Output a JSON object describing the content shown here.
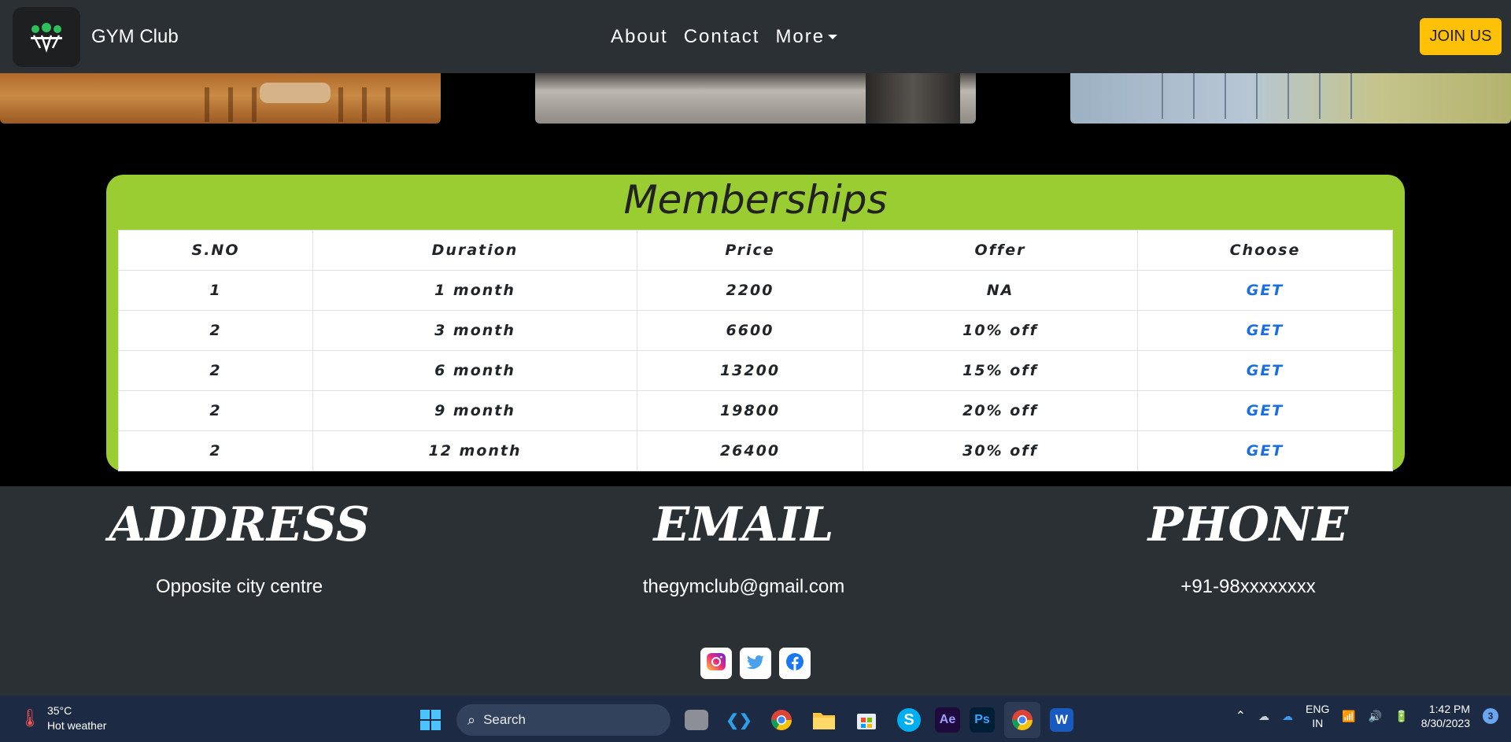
{
  "navbar": {
    "brand": "GYM Club",
    "links": [
      "About",
      "Contact",
      "More"
    ],
    "join_label": "JOIN US"
  },
  "memberships": {
    "title": "Memberships",
    "headers": [
      "S.NO",
      "Duration",
      "Price",
      "Offer",
      "Choose"
    ],
    "rows": [
      [
        "1",
        "1 month",
        "2200",
        "NA",
        "GET"
      ],
      [
        "2",
        "3 month",
        "6600",
        "10% off",
        "GET"
      ],
      [
        "2",
        "6 month",
        "13200",
        "15% off",
        "GET"
      ],
      [
        "2",
        "9 month",
        "19800",
        "20% off",
        "GET"
      ],
      [
        "2",
        "12 month",
        "26400",
        "30% off",
        "GET"
      ]
    ]
  },
  "footer": {
    "address_title": "ADDRESS",
    "address": "Opposite city centre",
    "email_title": "EMAIL",
    "email": "thegymclub@gmail.com",
    "phone_title": "PHONE",
    "phone": "+91-98xxxxxxxx"
  },
  "taskbar": {
    "temp": "35°C",
    "weather": "Hot weather",
    "search_label": "Search",
    "lang_top": "ENG",
    "lang_bottom": "IN",
    "time": "1:42 PM",
    "date": "8/30/2023",
    "notifications": "3"
  },
  "colors": {
    "navbar": "#2b3035",
    "accent_green": "#9acd32",
    "join_button": "#ffc107",
    "link_blue": "#1a6fe0"
  }
}
